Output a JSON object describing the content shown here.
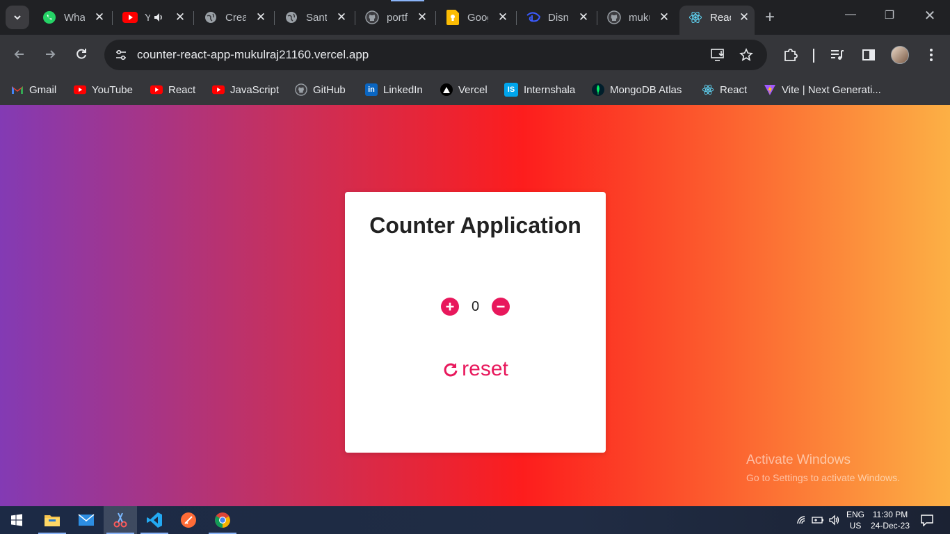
{
  "browser": {
    "tabs": [
      {
        "title": "WhatsApp",
        "icon": "whatsapp-icon"
      },
      {
        "title": "YouTube",
        "icon": "youtube-icon",
        "audio": true
      },
      {
        "title": "Create",
        "icon": "globe-icon"
      },
      {
        "title": "Santhosh",
        "icon": "globe-icon"
      },
      {
        "title": "portfolio",
        "icon": "github-icon"
      },
      {
        "title": "Google Keep",
        "icon": "keep-icon"
      },
      {
        "title": "Disney+",
        "icon": "disney-icon"
      },
      {
        "title": "mukulraj",
        "icon": "github-icon"
      },
      {
        "title": "React App",
        "icon": "react-icon",
        "active": true
      }
    ],
    "url": "counter-react-app-mukulraj21160.vercel.app",
    "bookmarks": [
      {
        "label": "Gmail",
        "icon": "gmail-icon"
      },
      {
        "label": "YouTube",
        "icon": "youtube-icon"
      },
      {
        "label": "React",
        "icon": "youtube-icon"
      },
      {
        "label": "JavaScript",
        "icon": "youtube-icon"
      },
      {
        "label": "GitHub",
        "icon": "github-icon"
      },
      {
        "label": "LinkedIn",
        "icon": "linkedin-icon"
      },
      {
        "label": "Vercel",
        "icon": "vercel-icon"
      },
      {
        "label": "Internshala",
        "icon": "internshala-icon"
      },
      {
        "label": "MongoDB Atlas",
        "icon": "mongodb-icon"
      },
      {
        "label": "React",
        "icon": "react-icon"
      },
      {
        "label": "Vite | Next Generati...",
        "icon": "vite-icon"
      }
    ]
  },
  "app": {
    "title": "Counter Application",
    "count": "0",
    "reset_label": "reset",
    "accent_color": "#e8185c"
  },
  "watermark": {
    "line1": "Activate Windows",
    "line2": "Go to Settings to activate Windows."
  },
  "taskbar": {
    "apps": [
      "start-icon",
      "file-explorer-icon",
      "mail-icon",
      "snipping-tool-icon",
      "vscode-icon",
      "postman-icon",
      "chrome-icon"
    ],
    "lang_top": "ENG",
    "lang_bottom": "US",
    "time": "11:30 PM",
    "date": "24-Dec-23"
  }
}
